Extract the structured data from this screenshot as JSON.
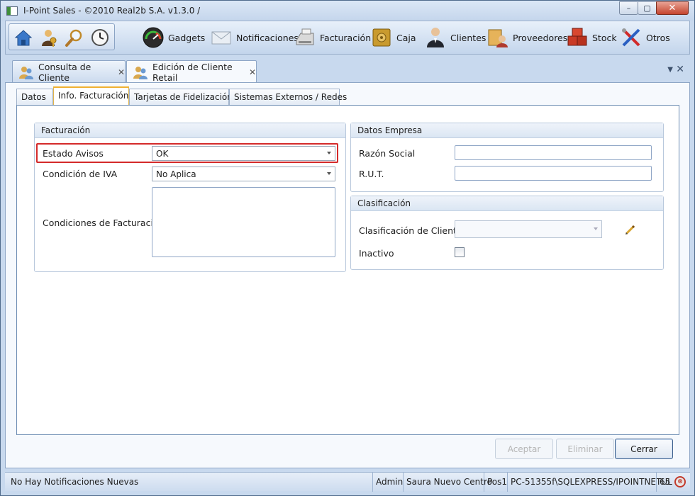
{
  "window": {
    "title": "I-Point Sales  - ©2010 Real2b S.A. v1.3.0 /",
    "controls": {
      "minimize": "–",
      "maximize": "▢",
      "close": "✕"
    }
  },
  "quickbar": [
    {
      "name": "home-icon"
    },
    {
      "name": "user-key-icon"
    },
    {
      "name": "magnifier-icon"
    },
    {
      "name": "clock-icon"
    }
  ],
  "toolbar": {
    "items": [
      {
        "label": "Gadgets",
        "icon": "gauge-icon"
      },
      {
        "label": "Notificaciones",
        "icon": "envelope-icon"
      },
      {
        "label": "Facturación",
        "icon": "cash-register-icon"
      },
      {
        "label": "Caja",
        "icon": "safe-icon"
      },
      {
        "label": "Clientes",
        "icon": "person-icon"
      },
      {
        "label": "Proveedores",
        "icon": "vendor-icon"
      },
      {
        "label": "Stock",
        "icon": "boxes-icon"
      },
      {
        "label": "Otros",
        "icon": "tools-icon"
      }
    ]
  },
  "doc_tabs": [
    {
      "label": "Consulta de Cliente",
      "close": "✕",
      "active": false
    },
    {
      "label": "Edición de Cliente Retail",
      "close": "✕",
      "active": true
    }
  ],
  "doc_tab_controls": {
    "menu": "▼",
    "close": "✕"
  },
  "subtabs": [
    {
      "label": "Datos",
      "active": false
    },
    {
      "label": "Info. Facturación",
      "active": true
    },
    {
      "label": "Tarjetas de Fidelización",
      "active": false
    },
    {
      "label": "Sistemas Externos / Redes",
      "active": false
    }
  ],
  "facturacion": {
    "header": "Facturación",
    "estado_avisos": {
      "label": "Estado Avisos",
      "value": "OK"
    },
    "condicion_iva": {
      "label": "Condición de IVA",
      "value": "No Aplica"
    },
    "condiciones": {
      "label": "Condiciones de Facturación",
      "value": ""
    }
  },
  "empresa": {
    "header": "Datos Empresa",
    "razon_social": {
      "label": "Razón Social",
      "value": ""
    },
    "rut": {
      "label": "R.U.T.",
      "value": ""
    }
  },
  "clasificacion": {
    "header": "Clasificación",
    "clasificacion_clientes": {
      "label": "Clasificación de Clientes",
      "value": ""
    },
    "inactivo": {
      "label": "Inactivo",
      "checked": false
    }
  },
  "buttons": {
    "aceptar": "Aceptar",
    "eliminar": "Eliminar",
    "cerrar": "Cerrar"
  },
  "statusbar": {
    "notificaciones": "No Hay Notificaciones Nuevas",
    "user": "Admin",
    "store": "Saura Nuevo Centro",
    "pos": "Pos1",
    "connection": "PC-51355f\\SQLEXPRESS/IPOINTNETUL",
    "number": "65",
    "error_icon": "⊗"
  },
  "colors": {
    "highlight": "#d42a2a",
    "window_bg": "#c8d9ee",
    "accent": "#f0b030"
  }
}
